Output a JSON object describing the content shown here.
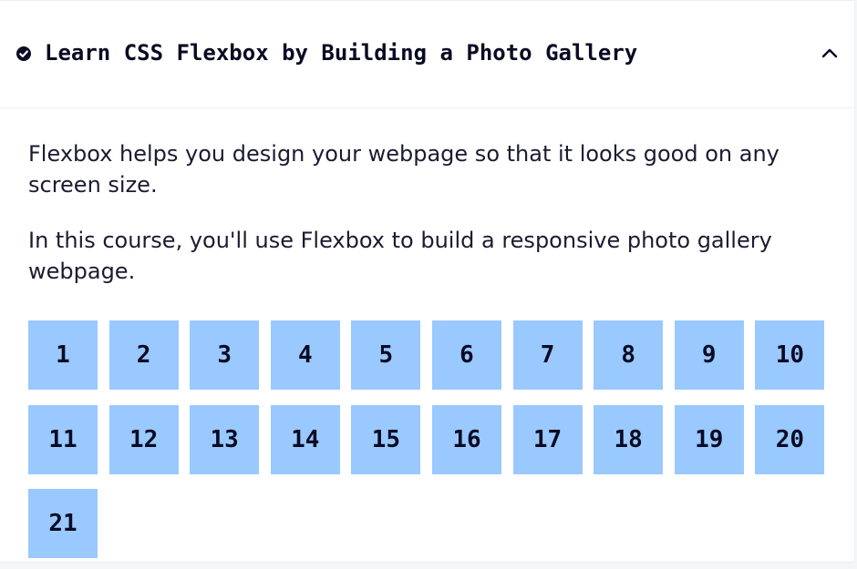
{
  "course": {
    "title": "Learn CSS Flexbox by Building a Photo Gallery",
    "completed_icon": "check-circle-icon",
    "collapse_icon": "chevron-up-icon"
  },
  "description": [
    "Flexbox helps you design your webpage so that it looks good on any screen size.",
    "In this course, you'll use Flexbox to build a responsive photo gallery webpage."
  ],
  "steps": [
    "1",
    "2",
    "3",
    "4",
    "5",
    "6",
    "7",
    "8",
    "9",
    "10",
    "11",
    "12",
    "13",
    "14",
    "15",
    "16",
    "17",
    "18",
    "19",
    "20",
    "21"
  ],
  "colors": {
    "tile_background": "#99c9ff",
    "text_dark": "#0a0a23"
  }
}
